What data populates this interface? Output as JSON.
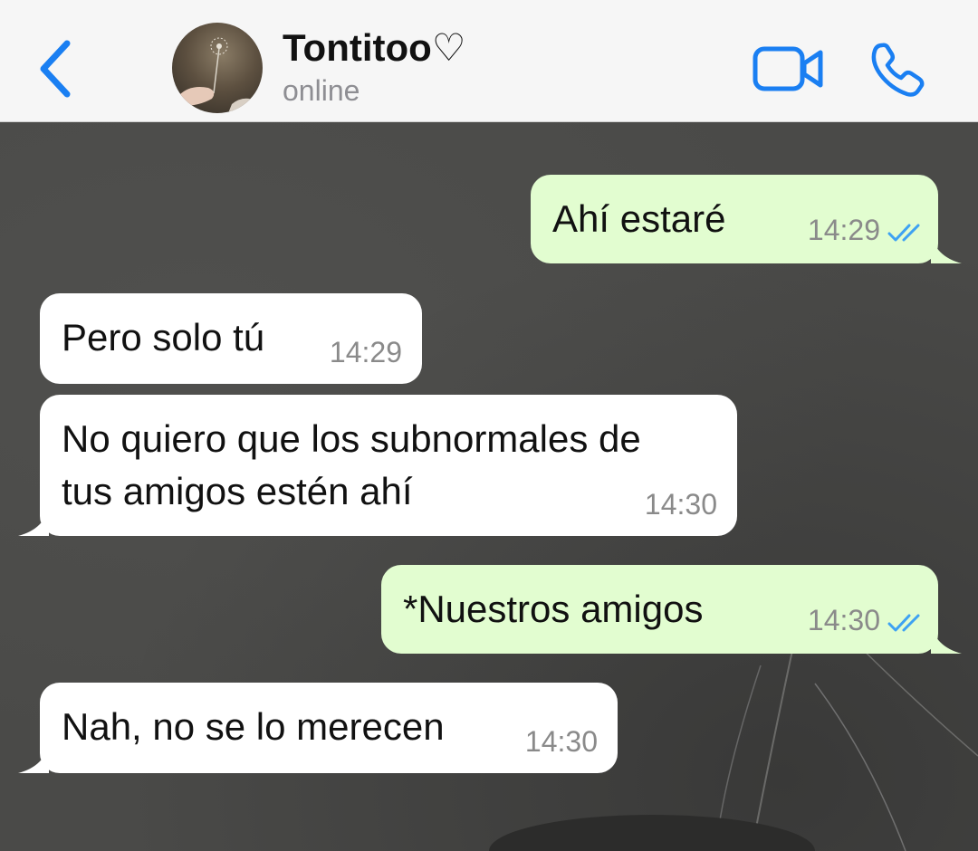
{
  "header": {
    "contact_name": "Tontitoo♡",
    "status": "online"
  },
  "icons": {
    "back": "chevron-left-icon",
    "video": "video-camera-icon",
    "call": "phone-icon",
    "read_receipt": "double-check-icon"
  },
  "colors": {
    "accent": "#1a7ff2",
    "outgoing_bubble": "#e2fdd0",
    "incoming_bubble": "#ffffff",
    "read_ticks": "#3ea2f2",
    "timestamp": "#8a8a8a"
  },
  "messages": [
    {
      "direction": "outgoing",
      "text": "Ahí estaré",
      "time": "14:29",
      "read": true
    },
    {
      "direction": "incoming",
      "text": "Pero solo tú",
      "time": "14:29"
    },
    {
      "direction": "incoming",
      "text": "No quiero que los subnormales de\ntus amigos estén ahí",
      "time": "14:30"
    },
    {
      "direction": "outgoing",
      "text": "*Nuestros amigos",
      "time": "14:30",
      "read": true
    },
    {
      "direction": "incoming",
      "text": "Nah, no se lo merecen",
      "time": "14:30"
    }
  ]
}
